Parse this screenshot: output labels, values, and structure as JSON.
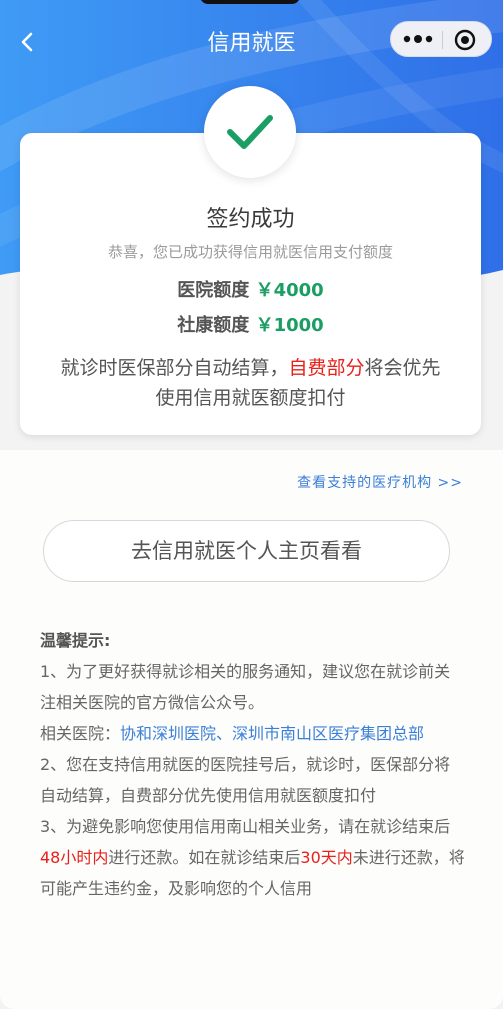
{
  "nav": {
    "title": "信用就医",
    "back_icon": "chevron-left-icon",
    "more_icon": "more-icon",
    "target_icon": "target-icon"
  },
  "card": {
    "title": "签约成功",
    "subtitle": "恭喜，您已成功获得信用就医信用支付额度",
    "hospital_label": "医院额度",
    "hospital_amount": "￥4000",
    "community_label": "社康额度",
    "community_amount": "￥1000",
    "desc_part1": "就诊时医保部分自动结算，",
    "desc_highlight": "自费部分",
    "desc_part2": "将会优先使用信用就医额度扣付"
  },
  "institutions_link": "查看支持的医疗机构 >>",
  "home_button": "去信用就医个人主页看看",
  "tips": {
    "heading": "温馨提示:",
    "item1": "1、为了更好获得就诊相关的服务通知，建议您在就诊前关注相关医院的官方微信公众号。",
    "hospitals_label": "相关医院：",
    "hospitals_value": "协和深圳医院、深圳市南山区医疗集团总部",
    "item2": "2、您在支持信用就医的医院挂号后，就诊时，医保部分将自动结算，自费部分优先使用信用就医额度扣付",
    "item3_a": "3、为避免影响您使用信用南山相关业务，请在就诊结束后",
    "item3_red1": "48小时内",
    "item3_b": "进行还款。如在就诊结束后",
    "item3_red2": "30天内",
    "item3_c": "未进行还款，将可能产生违约金，及影响您的个人信用"
  },
  "colors": {
    "brand_blue": "#3a8cf0",
    "amount_green": "#1a9e63",
    "alert_red": "#e8211a",
    "link_blue": "#3a7fd8"
  }
}
